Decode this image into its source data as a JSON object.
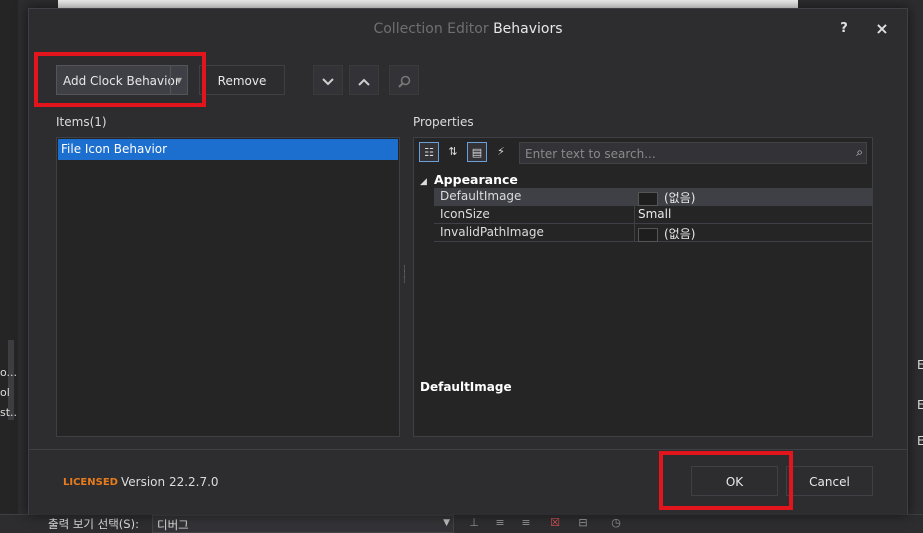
{
  "dialog": {
    "title_prefix": "Collection Editor",
    "title_main": "Behaviors",
    "help_label": "?",
    "close_label": "×"
  },
  "toolbar": {
    "add_label": "Add Clock Behavior",
    "remove_label": "Remove",
    "move_down_icon": "chevron-down-icon",
    "move_up_icon": "chevron-up-icon",
    "search_icon": "search-icon"
  },
  "items": {
    "header": "Items(1)",
    "list": [
      {
        "label": "File Icon Behavior",
        "selected": true
      }
    ]
  },
  "properties": {
    "header": "Properties",
    "search_placeholder": "Enter text to search...",
    "category": "Appearance",
    "rows": [
      {
        "name": "DefaultImage",
        "value": "(없음)",
        "has_swatch": true,
        "selected": true
      },
      {
        "name": "IconSize",
        "value": "Small",
        "has_swatch": false,
        "selected": false
      },
      {
        "name": "InvalidPathImage",
        "value": "(없음)",
        "has_swatch": true,
        "selected": false
      }
    ],
    "description_title": "DefaultImage"
  },
  "footer": {
    "licensed_label": "LICENSED",
    "version_label": "Version 22.2.7.0",
    "ok_label": "OK",
    "cancel_label": "Cancel"
  },
  "background": {
    "output_label": "출력 보기 선택(S):",
    "output_value": "디버그",
    "left_texts": [
      "o...",
      "ol",
      "st..."
    ],
    "right_letters": [
      "E",
      "E",
      "E"
    ]
  },
  "colors": {
    "highlight": "#e3151c",
    "selection": "#1c6ecf",
    "licensed": "#e87b1c"
  }
}
